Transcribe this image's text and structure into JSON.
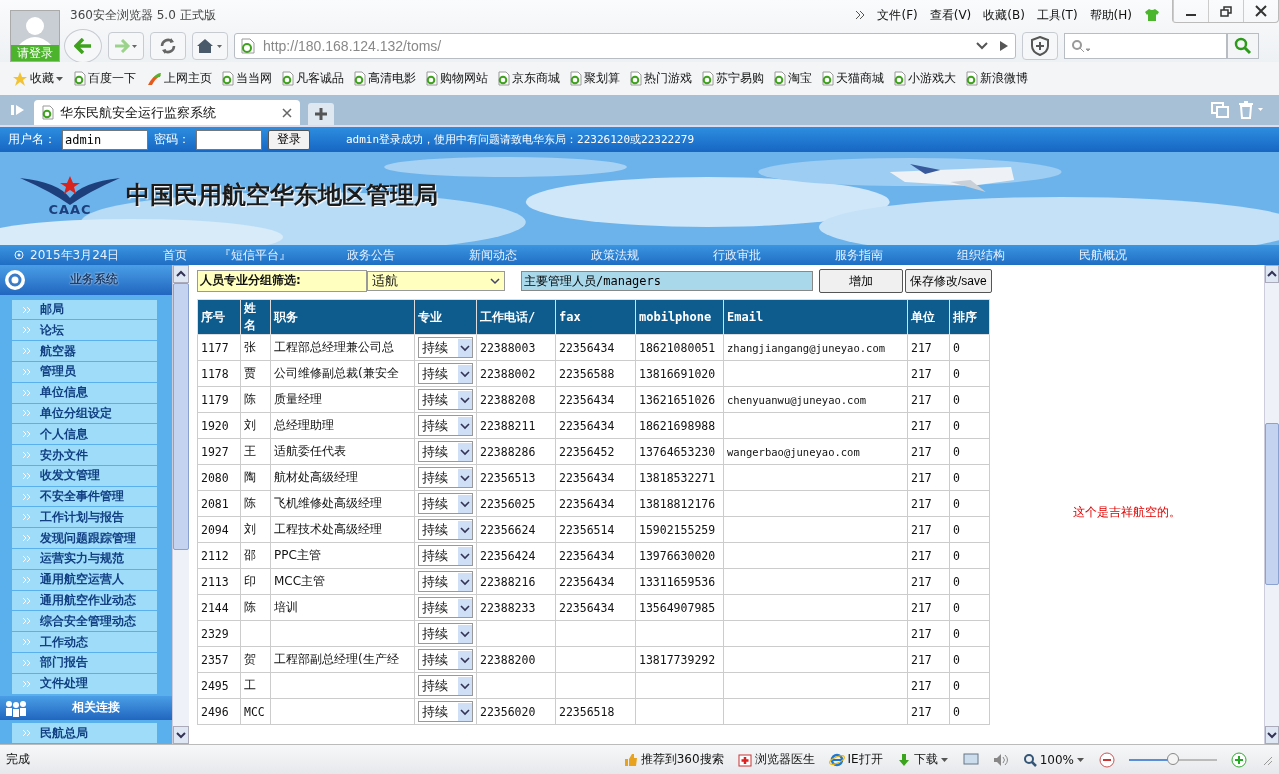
{
  "browser": {
    "title": "360安全浏览器 5.0 正式版",
    "login_label": "请登录",
    "menu": [
      "文件(F)",
      "查看(V)",
      "收藏(B)",
      "工具(T)",
      "帮助(H)"
    ],
    "url": "http://180.168.124.132/toms/",
    "favorites_label": "收藏",
    "bookmarks": [
      {
        "label": "百度一下",
        "kind": "page"
      },
      {
        "label": "上网主页",
        "kind": "hao"
      },
      {
        "label": "当当网",
        "kind": "page"
      },
      {
        "label": "凡客诚品",
        "kind": "page"
      },
      {
        "label": "高清电影",
        "kind": "page"
      },
      {
        "label": "购物网站",
        "kind": "page"
      },
      {
        "label": "京东商城",
        "kind": "page"
      },
      {
        "label": "聚划算",
        "kind": "page"
      },
      {
        "label": "热门游戏",
        "kind": "page"
      },
      {
        "label": "苏宁易购",
        "kind": "page"
      },
      {
        "label": "淘宝",
        "kind": "page"
      },
      {
        "label": "天猫商城",
        "kind": "page"
      },
      {
        "label": "小游戏大",
        "kind": "page"
      },
      {
        "label": "新浪微博",
        "kind": "page"
      }
    ],
    "tabs": [
      {
        "title": "华东民航安全运行监察系统",
        "selected": true
      }
    ]
  },
  "login_bar": {
    "username_label": "用户名：",
    "username": "admin",
    "password_label": "密码：",
    "login_button": "登录",
    "message": "admin登录成功，使用中有问题请致电华东局：22326120或22322279"
  },
  "banner": {
    "logo_text": "CAAC",
    "title": "中国民用航空华东地区管理局"
  },
  "nav": {
    "date": "2015年3月24日",
    "items": [
      "首页",
      "『短信平台』",
      "政务公告",
      "新闻动态",
      "政策法规",
      "行政审批",
      "服务指南",
      "组织结构",
      "民航概况"
    ]
  },
  "sidebar": {
    "sections": [
      {
        "title": "业务系统",
        "kind": "system",
        "items": [
          "邮局",
          "论坛",
          "航空器",
          "管理员",
          "单位信息",
          "单位分组设定",
          "个人信息",
          "安办文件",
          "收发文管理",
          "不安全事件管理",
          "工作计划与报告",
          "发现问题跟踪管理",
          "运营实力与规范",
          "通用航空运营人",
          "通用航空作业动态",
          "综合安全管理动态",
          "工作动态",
          "部门报告",
          "文件处理"
        ]
      },
      {
        "title": "相关连接",
        "kind": "links",
        "items": [
          "民航总局"
        ]
      }
    ]
  },
  "filter": {
    "label": "人员专业分组筛选:",
    "group": "适航",
    "role": "主要管理人员/managers",
    "add_button": "增加",
    "save_button": "保存修改/save"
  },
  "table": {
    "columns": [
      "序号",
      "姓名",
      "职务",
      "专业",
      "工作电话/",
      "fax",
      "mobilphone",
      "Email",
      "单位",
      "排序"
    ],
    "rows": [
      {
        "id": "1177",
        "name": "张",
        "title": "工程部总经理兼公司总",
        "major": "持续",
        "phone": "22388003",
        "fax": "22356434",
        "mobile": "18621080051",
        "email": "zhangjiangang@juneyao.com",
        "unit": "217",
        "order": "0"
      },
      {
        "id": "1178",
        "name": "贾",
        "title": "公司维修副总裁(兼安全",
        "major": "持续",
        "phone": "22388002",
        "fax": "22356588",
        "mobile": "13816691020",
        "unit": "217",
        "order": "0"
      },
      {
        "id": "1179",
        "name": "陈",
        "title": "质量经理",
        "major": "持续",
        "phone": "22388208",
        "fax": "22356434",
        "mobile": "13621651026",
        "email": "chenyuanwu@juneyao.com",
        "unit": "217",
        "order": "0"
      },
      {
        "id": "1920",
        "name": "刘",
        "title": "总经理助理",
        "major": "持续",
        "phone": "22388211",
        "fax": "22356434",
        "mobile": "18621698988",
        "unit": "217",
        "order": "0"
      },
      {
        "id": "1927",
        "name": "王",
        "title": "适航委任代表",
        "major": "持续",
        "phone": "22388286",
        "fax": "22356452",
        "mobile": "13764653230",
        "email": "wangerbao@juneyao.com",
        "unit": "217",
        "order": "0"
      },
      {
        "id": "2080",
        "name": "陶",
        "title": "航材处高级经理",
        "major": "持续",
        "phone": "22356513",
        "fax": "22356434",
        "mobile": "13818532271",
        "unit": "217",
        "order": "0"
      },
      {
        "id": "2081",
        "name": "陈",
        "title": "飞机维修处高级经理",
        "major": "持续",
        "phone": "22356025",
        "fax": "22356434",
        "mobile": "13818812176",
        "unit": "217",
        "order": "0"
      },
      {
        "id": "2094",
        "name": "刘",
        "title": "工程技术处高级经理",
        "major": "持续",
        "phone": "22356624",
        "fax": "22356514",
        "mobile": "15902155259",
        "unit": "217",
        "order": "0"
      },
      {
        "id": "2112",
        "name": "邵",
        "title": "PPC主管",
        "major": "持续",
        "phone": "22356424",
        "fax": "22356434",
        "mobile": "13976630020",
        "unit": "217",
        "order": "0"
      },
      {
        "id": "2113",
        "name": "印",
        "title": "MCC主管",
        "major": "持续",
        "phone": "22388216",
        "fax": "22356434",
        "mobile": "13311659536",
        "unit": "217",
        "order": "0"
      },
      {
        "id": "2144",
        "name": "陈",
        "title": "培训",
        "major": "持续",
        "phone": "22388233",
        "fax": "22356434",
        "mobile": "13564907985",
        "unit": "217",
        "order": "0"
      },
      {
        "id": "2329",
        "major": "持续",
        "unit": "217",
        "order": "0"
      },
      {
        "id": "2357",
        "name": "贺",
        "title": "工程部副总经理(生产经",
        "major": "持续",
        "phone": "22388200",
        "mobile": "13817739292",
        "unit": "217",
        "order": "0"
      },
      {
        "id": "2495",
        "name": "工",
        "major": "持续",
        "unit": "217",
        "order": "0"
      },
      {
        "id": "2496",
        "name": "MCC",
        "major": "持续",
        "phone": "22356020",
        "fax": "22356518",
        "unit": "217",
        "order": "0"
      }
    ]
  },
  "note": "这个是吉祥航空的。",
  "status_bar": {
    "status": "完成",
    "items": [
      {
        "label": "推荐到360搜索",
        "kind": "thumb"
      },
      {
        "label": "浏览器医生",
        "kind": "doctor"
      },
      {
        "label": "IE打开",
        "kind": "ie"
      },
      {
        "label": "下载",
        "kind": "download"
      }
    ],
    "zoom": "100%",
    "zoom_slider": {
      "level": 0.5
    }
  }
}
